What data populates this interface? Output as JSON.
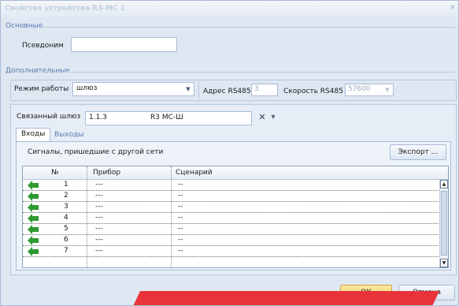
{
  "window": {
    "title": "Свойства устройства R3-МС 1",
    "close_glyph": "×"
  },
  "basic": {
    "group_title": "Основные",
    "alias_label": "Псевдоним",
    "alias_value": ""
  },
  "extra": {
    "group_title": "Дополнительные",
    "mode_label": "Режим работы",
    "mode_value": "шлюз",
    "rs485_address_label": "Адрес RS485",
    "rs485_address_value": "3",
    "rs485_speed_label": "Скорость RS485",
    "rs485_speed_value": "57600"
  },
  "gateway": {
    "label": "Связанный шлюз",
    "value_address": "1.1.3",
    "value_name": "R3 МС-Ш",
    "clear_glyph": "✕",
    "dropdown_glyph": "▾"
  },
  "tabs": [
    {
      "label": "Входы",
      "active": true
    },
    {
      "label": "Выходы",
      "active": false
    }
  ],
  "signals": {
    "title": "Сигналы, пришедшие с другой сети",
    "export_label": "Экспорт ..."
  },
  "grid": {
    "columns": [
      "№",
      "Прибор",
      "Сценарий"
    ],
    "rows": [
      {
        "num": "1",
        "device": "---",
        "scenario": "--"
      },
      {
        "num": "2",
        "device": "---",
        "scenario": "--"
      },
      {
        "num": "3",
        "device": "---",
        "scenario": "--"
      },
      {
        "num": "4",
        "device": "---",
        "scenario": "--"
      },
      {
        "num": "5",
        "device": "---",
        "scenario": "--"
      },
      {
        "num": "6",
        "device": "---",
        "scenario": "--"
      },
      {
        "num": "7",
        "device": "---",
        "scenario": "--"
      }
    ],
    "row_icon": "green-left-arrow-icon",
    "scroll_up_glyph": "▲",
    "scroll_down_glyph": "▼"
  },
  "footer": {
    "ok_label": "ОК",
    "cancel_label": "Отмена"
  },
  "colors": {
    "accent": "#587bb0",
    "ok_button": "#f7cd5d",
    "arrow_green": "#2f9a2f",
    "watermark": "#e8333a"
  }
}
